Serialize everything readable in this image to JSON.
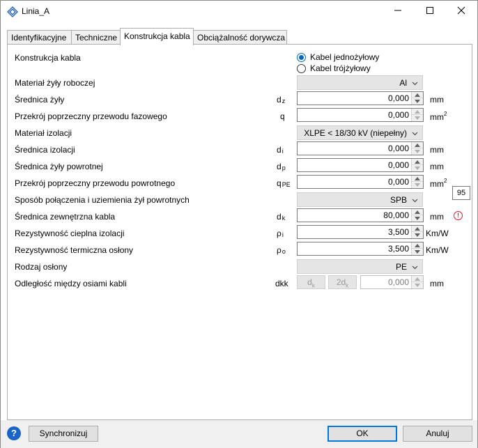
{
  "window": {
    "title": "Linia_A",
    "icon": "diamond-link-icon",
    "controls": [
      "minimize-icon",
      "maximize-icon",
      "close-icon"
    ]
  },
  "tabs": [
    {
      "label": "Identyfikacyjne",
      "active": false
    },
    {
      "label": "Techniczne",
      "active": false
    },
    {
      "label": "Konstrukcja kabla",
      "active": true
    },
    {
      "label": "Obciążalność dorywcza",
      "active": false
    }
  ],
  "form": {
    "construction_label": "Konstrukcja kabla",
    "radio_single": "Kabel jednożyłowy",
    "radio_triple": "Kabel trójżyłowy",
    "radio_selected": "single",
    "rows": {
      "conductor_material": {
        "label": "Materiał żyły roboczej",
        "value": "Al"
      },
      "conductor_diameter": {
        "label": "Średnica żyły",
        "sym": "d",
        "sub": "z",
        "value": "0,000",
        "unit": "mm"
      },
      "phase_cross_section": {
        "label": "Przekrój poprzeczny przewodu fazowego",
        "sym": "q",
        "sub": "",
        "value": "0,000",
        "unit": "mm",
        "unit_sup": "2"
      },
      "insulation_material": {
        "label": "Materiał izolacji",
        "value": "XLPE < 18/30 kV (niepełny)"
      },
      "insulation_diameter": {
        "label": "Średnica izolacji",
        "sym": "d",
        "sub": "i",
        "value": "0,000",
        "unit": "mm"
      },
      "return_diameter": {
        "label": "Średnica żyły powrotnej",
        "sym": "d",
        "sub": "p",
        "value": "0,000",
        "unit": "mm"
      },
      "return_cross_section": {
        "label": "Przekrój poprzeczny przewodu powrotnego",
        "sym": "q",
        "sub": "PE",
        "value": "0,000",
        "unit": "mm",
        "unit_sup": "2"
      },
      "bonding_method": {
        "label": "Sposób połączenia i uziemienia żył powrotnych",
        "value": "SPB"
      },
      "outer_diameter": {
        "label": "Średnica zewnętrzna kabla",
        "sym": "d",
        "sub": "k",
        "value": "80,000",
        "unit": "mm",
        "warning": "!"
      },
      "insulation_resistivity": {
        "label": "Rezystywność cieplna izolacji",
        "sym": "ρ",
        "sub": "i",
        "value": "3,500",
        "unit": "Km/W"
      },
      "sheath_resistivity": {
        "label": "Rezystywność termiczna osłony",
        "sym": "ρ",
        "sub": "o",
        "value": "3,500",
        "unit": "Km/W"
      },
      "sheath_type": {
        "label": "Rodzaj osłony",
        "value": "PE"
      },
      "axis_distance": {
        "label": "Odległość między osiami kabli",
        "sym": "dkk",
        "btn1": "d",
        "btn1_sub": "k",
        "btn2": "2d",
        "btn2_sub": "k",
        "value": "0,000",
        "unit": "mm"
      }
    }
  },
  "tooltip": "95",
  "footer": {
    "help": "?",
    "sync_label": "Synchronizuj",
    "ok_label": "OK",
    "cancel_label": "Anuluj"
  },
  "colors": {
    "accent": "#0078d7",
    "warning": "#e81123",
    "help": "#1a64c8"
  }
}
